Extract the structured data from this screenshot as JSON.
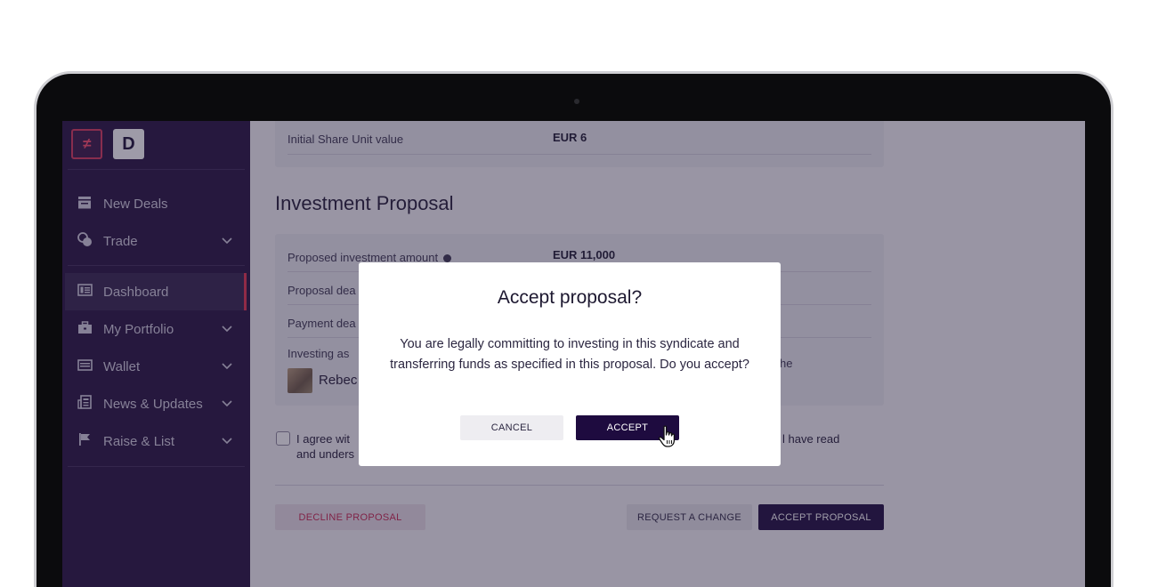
{
  "sidebar": {
    "items": [
      {
        "label": "New Deals",
        "icon": "deals-icon",
        "chevron": false
      },
      {
        "label": "Trade",
        "icon": "trade-icon",
        "chevron": true
      },
      {
        "label": "Dashboard",
        "icon": "dashboard-icon",
        "chevron": false,
        "active": true
      },
      {
        "label": "My Portfolio",
        "icon": "briefcase-icon",
        "chevron": true
      },
      {
        "label": "Wallet",
        "icon": "wallet-icon",
        "chevron": true
      },
      {
        "label": "News & Updates",
        "icon": "news-icon",
        "chevron": true
      },
      {
        "label": "Raise & List",
        "icon": "flag-icon",
        "chevron": true
      }
    ]
  },
  "share_info": {
    "label": "Initial Share Unit value",
    "value": "EUR 6"
  },
  "proposal": {
    "title": "Investment Proposal",
    "amount_label": "Proposed investment amount",
    "amount_value": "EUR 11,000",
    "deadline_label_partial": "Proposal dea",
    "payment_label_partial": "Payment dea",
    "investing_as_label": "Investing as",
    "investor_name_partial": "Rebec",
    "trailing_text_partial": "he"
  },
  "agreement": {
    "line1_partial": "I agree wit",
    "line1_end": "l have read",
    "line2_partial": "and unders"
  },
  "actions": {
    "decline": "DECLINE PROPOSAL",
    "request_change": "REQUEST A CHANGE",
    "accept": "ACCEPT PROPOSAL"
  },
  "modal": {
    "title": "Accept proposal?",
    "body": "You are legally committing to investing in this syndicate and transferring funds as specified in this proposal. Do you accept?",
    "cancel": "CANCEL",
    "accept": "ACCEPT"
  },
  "colors": {
    "sidebar_bg": "#25113f",
    "accent": "#e6334f",
    "primary_button": "#1e0b3f"
  }
}
